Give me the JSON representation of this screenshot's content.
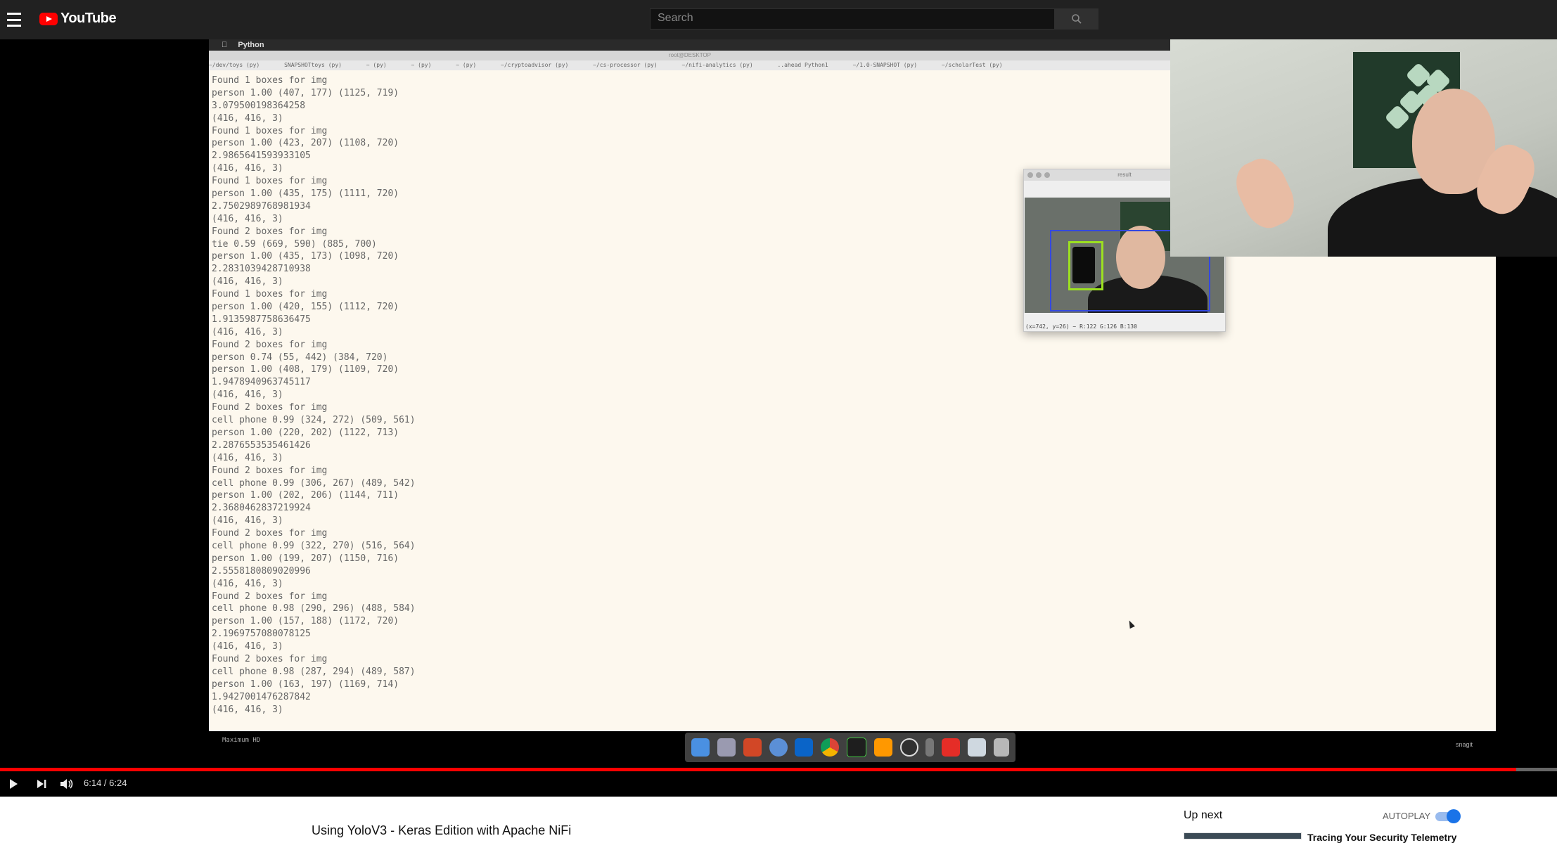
{
  "header": {
    "logo_text": "YouTube",
    "search_placeholder": "Search"
  },
  "terminal_window": {
    "app_name": "Python",
    "window_title": "root@DESKTOP",
    "tabs": [
      "~/dev/toys (py)",
      "SNAPSHOTtoys (py)",
      "~ (py)",
      "~ (py)",
      "~ (py)",
      "~/cryptoadvisor (py)",
      "~/cs-processor (py)",
      "~/nifi-analytics (py)",
      "..ahead Python1",
      "~/1.0-SNAPSHOT (py)",
      "~/scholarTest (py)"
    ],
    "lines": [
      "Found 1 boxes for img",
      "person 1.00 (407, 177) (1125, 719)",
      "3.079500198364258",
      "(416, 416, 3)",
      "Found 1 boxes for img",
      "person 1.00 (423, 207) (1108, 720)",
      "2.9865641593933105",
      "(416, 416, 3)",
      "Found 1 boxes for img",
      "person 1.00 (435, 175) (1111, 720)",
      "2.7502989768981934",
      "(416, 416, 3)",
      "Found 2 boxes for img",
      "tie 0.59 (669, 590) (885, 700)",
      "person 1.00 (435, 173) (1098, 720)",
      "2.2831039428710938",
      "(416, 416, 3)",
      "Found 1 boxes for img",
      "person 1.00 (420, 155) (1112, 720)",
      "1.9135987758636475",
      "(416, 416, 3)",
      "Found 2 boxes for img",
      "person 0.74 (55, 442) (384, 720)",
      "person 1.00 (408, 179) (1109, 720)",
      "1.9478940963745117",
      "(416, 416, 3)",
      "Found 2 boxes for img",
      "cell phone 0.99 (324, 272) (509, 561)",
      "person 1.00 (220, 202) (1122, 713)",
      "2.2876553535461426",
      "(416, 416, 3)",
      "Found 2 boxes for img",
      "cell phone 0.99 (306, 267) (489, 542)",
      "person 1.00 (202, 206) (1144, 711)",
      "2.3680462837219924",
      "(416, 416, 3)",
      "Found 2 boxes for img",
      "cell phone 0.99 (322, 270) (516, 564)",
      "person 1.00 (199, 207) (1150, 716)",
      "2.5558180809020996",
      "(416, 416, 3)",
      "Found 2 boxes for img",
      "cell phone 0.98 (290, 296) (488, 584)",
      "person 1.00 (157, 188) (1172, 720)",
      "2.1969757080078125",
      "(416, 416, 3)",
      "Found 2 boxes for img",
      "cell phone 0.98 (287, 294) (489, 587)",
      "person 1.00 (163, 197) (1169, 714)",
      "1.9427001476287842",
      "(416, 416, 3)"
    ]
  },
  "detection_window": {
    "title": "result",
    "status": "(x=742, y=26) ~ R:122 G:126 B:130"
  },
  "desktop": {
    "left_label": "Maximum HD",
    "right_label": "snagit"
  },
  "player": {
    "time": "6:14 / 6:24",
    "progress": 0.974
  },
  "video": {
    "title": "Using YoloV3 - Keras Edition with Apache NiFi"
  },
  "sidebar": {
    "up_next": "Up next",
    "autoplay": "AUTOPLAY",
    "autoplay_on": true,
    "next_video_title": "Tracing Your Security Telemetry"
  }
}
